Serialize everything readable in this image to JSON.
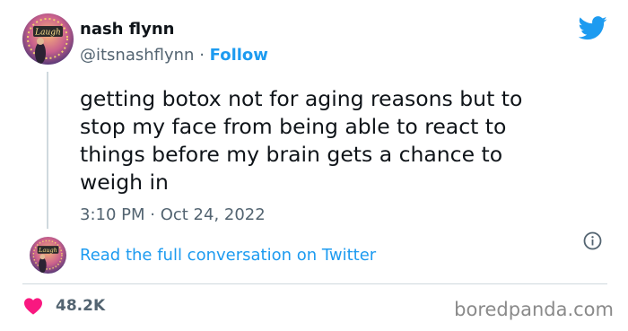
{
  "author": {
    "display_name": "nash flynn",
    "handle": "@itsnashflynn",
    "separator": " · ",
    "follow_label": "Follow",
    "avatar_sign_text": "Laugh"
  },
  "tweet": {
    "text": "getting botox not for aging reasons but to stop my face from being able to react to things before my brain gets a chance to weigh in",
    "timestamp": "3:10 PM · Oct 24, 2022"
  },
  "conversation": {
    "read_label": "Read the full conversation on Twitter",
    "avatar_sign_text": "Laugh"
  },
  "engagement": {
    "likes": "48.2K"
  },
  "watermark": "boredpanda.com",
  "icons": {
    "brand": "twitter-bird-icon",
    "info": "info-icon",
    "like": "heart-icon"
  },
  "colors": {
    "accent": "#1d9bf0",
    "like": "#f91880",
    "secondary_text": "#536471",
    "primary_text": "#0f1419"
  }
}
